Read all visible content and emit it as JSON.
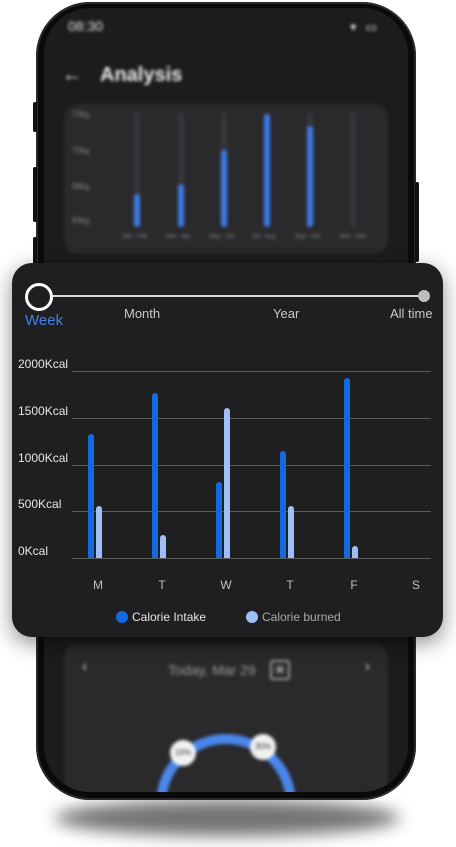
{
  "status_bar": {
    "time": "08:30",
    "icons": "▾ ▭"
  },
  "header": {
    "back_icon": "←",
    "title": "Analysis"
  },
  "bg_chart": {
    "y_labels": [
      "72kg",
      "70kg",
      "68kg",
      "64kg"
    ],
    "x_labels": [
      "Jan - Feb",
      "Mar - Apr",
      "May - Jun",
      "Jul - Aug",
      "Sep - Oct",
      "Nov - Dec"
    ]
  },
  "lower_card": {
    "prev": "‹",
    "next": "›",
    "date": "Today, Mar 29",
    "calendar_icon": "▣",
    "pct_left": "10%",
    "pct_right": "30%"
  },
  "period_options": [
    "Week",
    "Month",
    "Year",
    "All time"
  ],
  "chart_data": {
    "type": "bar",
    "categories": [
      "M",
      "T",
      "W",
      "T",
      "F",
      "S"
    ],
    "series": [
      {
        "name": "Calorie Intake",
        "values": [
          1330,
          1770,
          810,
          1140,
          1930,
          0
        ]
      },
      {
        "name": "Calorie burned",
        "values": [
          560,
          250,
          1600,
          560,
          130,
          0
        ]
      }
    ],
    "y_ticks": [
      "2000Kcal",
      "1500Kcal",
      "1000Kcal",
      "500Kcal",
      "0Kcal"
    ],
    "ylim": [
      0,
      2000
    ],
    "legend": "bottom",
    "colors": {
      "intake": "#1468e0",
      "burned": "#9ec0f7"
    }
  }
}
